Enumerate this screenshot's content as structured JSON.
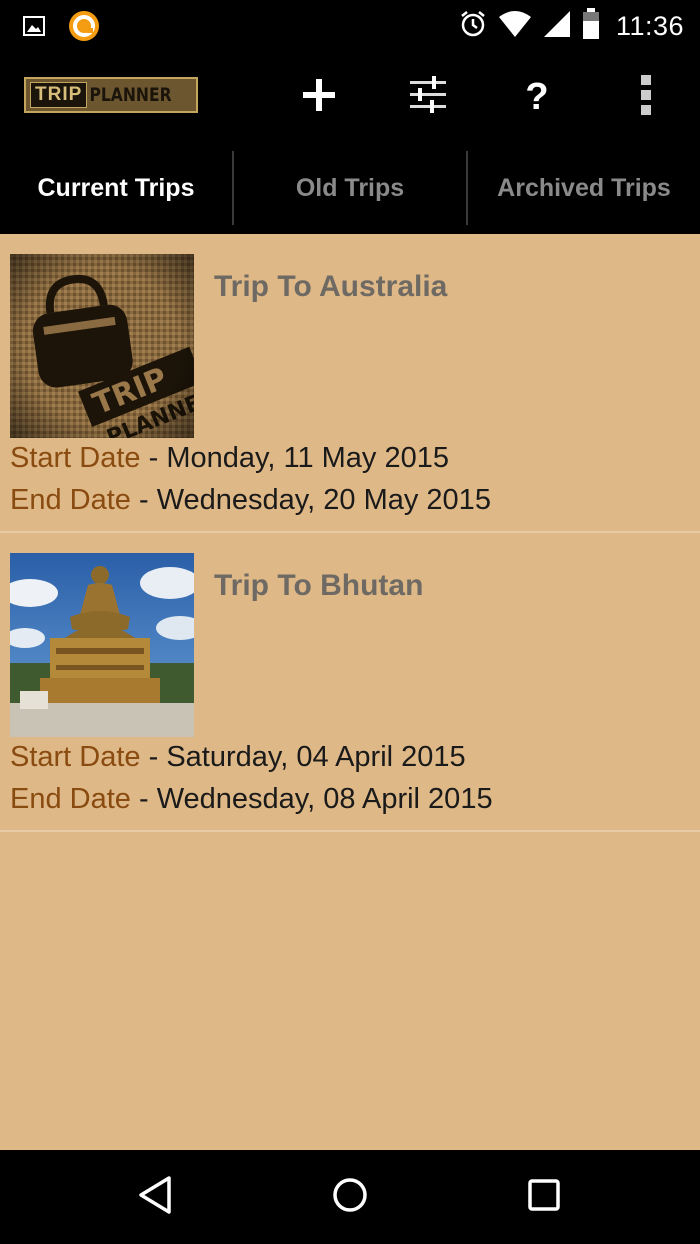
{
  "status_bar": {
    "time": "11:36",
    "icons": [
      "image-icon",
      "app-notification-icon",
      "alarm-icon",
      "wifi-icon",
      "signal-icon",
      "battery-icon"
    ]
  },
  "action_bar": {
    "logo_trip": "TRIP",
    "logo_planner": "PLANNER",
    "actions": [
      "add-icon",
      "filter-icon",
      "help-icon",
      "overflow-menu-icon"
    ],
    "help_glyph": "?"
  },
  "tabs": [
    {
      "label": "Current Trips",
      "active": true
    },
    {
      "label": "Old Trips",
      "active": false
    },
    {
      "label": "Archived Trips",
      "active": false
    }
  ],
  "trips": [
    {
      "title": "Trip To Australia",
      "start_label": "Start Date",
      "start_value": " - Monday, 11 May 2015",
      "end_label": "End Date",
      "end_value": " - Wednesday, 20 May 2015",
      "thumbnail": "trip-planner-bag-icon"
    },
    {
      "title": "Trip To Bhutan",
      "start_label": "Start Date",
      "start_value": " - Saturday, 04 April 2015",
      "end_label": "End Date",
      "end_value": " - Wednesday, 08 April 2015",
      "thumbnail": "buddha-statue-photo"
    }
  ],
  "colors": {
    "list_background": "#deb887",
    "date_label": "#8a4b10",
    "title": "#6e6a63",
    "active_tab": "#ffffff",
    "inactive_tab": "#8a8a8a"
  },
  "nav_bar": [
    "back-icon",
    "home-icon",
    "recent-apps-icon"
  ]
}
